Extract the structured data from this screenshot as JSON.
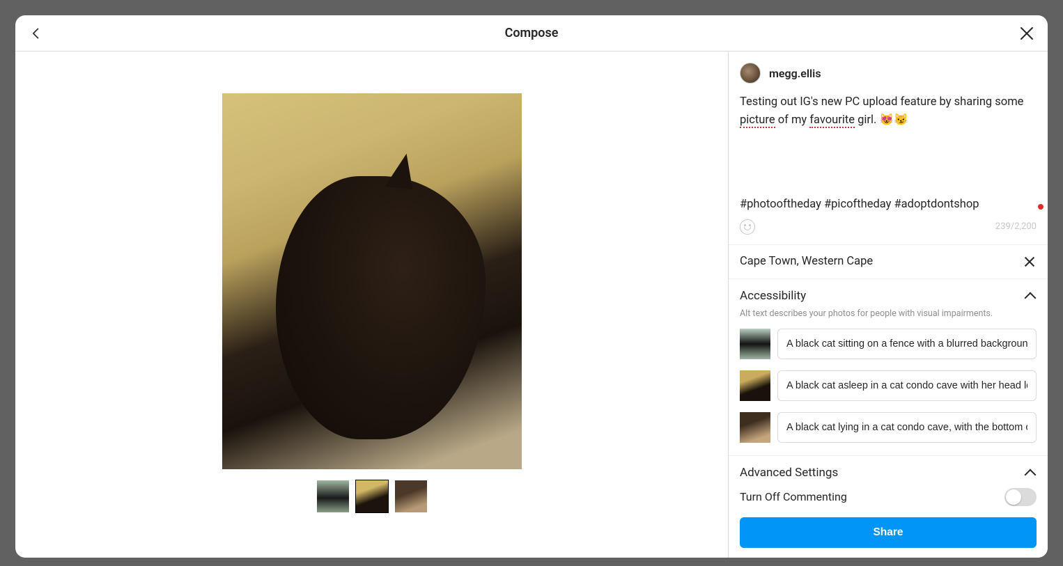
{
  "header": {
    "title": "Compose"
  },
  "user": {
    "username": "megg.ellis"
  },
  "caption": {
    "text_pre": "Testing out IG's new PC upload feature by sharing some ",
    "word1": "picture",
    "text_mid": " of my ",
    "word2": "favourite",
    "text_post": " girl. 😻😼",
    "hashtags": "#photooftheday #picoftheday #adoptdontshop",
    "counter": "239/2,200"
  },
  "location": {
    "value": "Cape Town, Western Cape"
  },
  "accessibility": {
    "title": "Accessibility",
    "help": "Alt text describes your photos for people with visual impairments.",
    "alts": [
      "A black cat sitting on a fence with a blurred background",
      "A black cat asleep in a cat condo cave with her head leaning",
      "A black cat lying in a cat condo cave, with the bottom of"
    ]
  },
  "advanced": {
    "title": "Advanced Settings",
    "commenting_label": "Turn Off Commenting"
  },
  "share": {
    "label": "Share"
  }
}
